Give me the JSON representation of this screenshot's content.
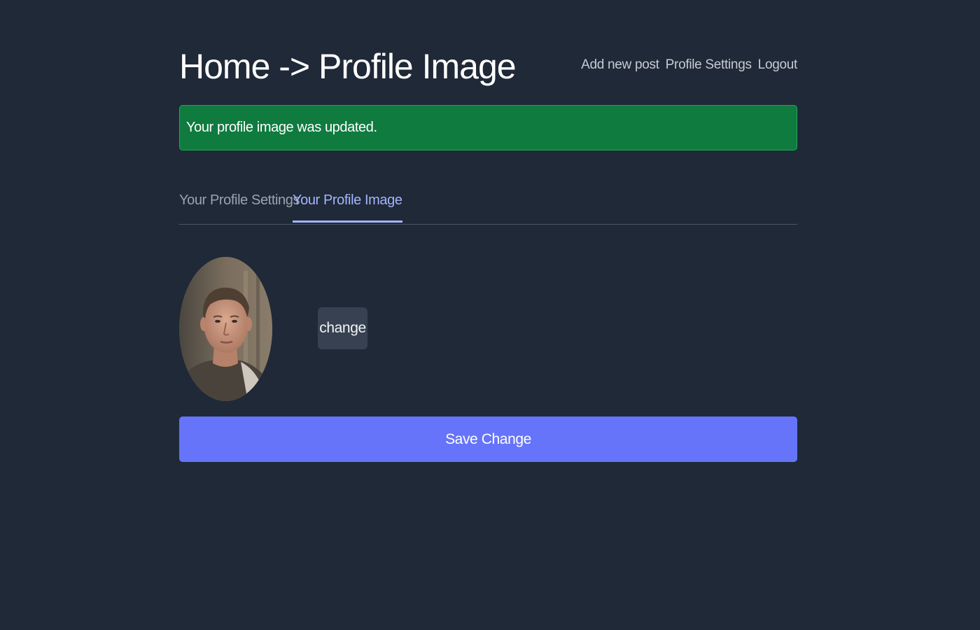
{
  "header": {
    "title": "Home -> Profile Image",
    "nav": {
      "add_post": "Add new post",
      "profile_settings": "Profile Settings",
      "logout": "Logout"
    }
  },
  "alert": {
    "message": "Your profile image was updated.",
    "color": "#0f7b3e"
  },
  "tabs": {
    "settings": "Your Profile Settings",
    "image": "Your Profile Image",
    "active": "image",
    "active_color": "#a5b4fc"
  },
  "profile_image": {
    "icon": "user-photo-avatar"
  },
  "buttons": {
    "change": "change",
    "save": "Save Change",
    "save_color": "#6574f8"
  }
}
